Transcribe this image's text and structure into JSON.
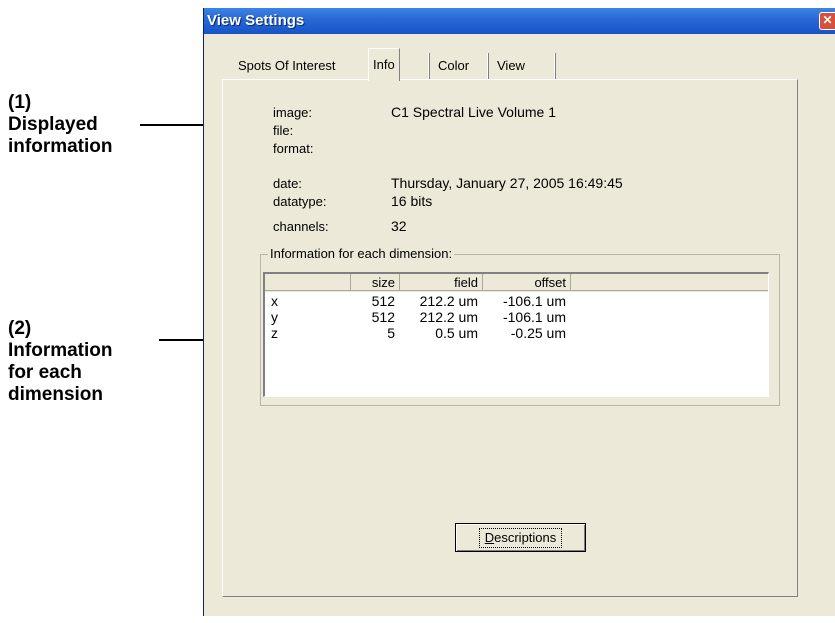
{
  "callouts": [
    {
      "number": "(1)",
      "lines": [
        "Displayed",
        "information"
      ]
    },
    {
      "number": "(2)",
      "lines": [
        "Information",
        "for each",
        "dimension"
      ]
    }
  ],
  "window": {
    "title": "View Settings",
    "close_glyph": "✕",
    "close_icon": "close-icon"
  },
  "tabs": [
    {
      "label": "Spots Of Interest",
      "active": false
    },
    {
      "label": "Info",
      "active": true
    },
    {
      "label": "Color",
      "active": false
    },
    {
      "label": "View",
      "active": false
    }
  ],
  "info": [
    {
      "label": "image:",
      "value": "C1 Spectral Live Volume 1"
    },
    {
      "label": "file:",
      "value": ""
    },
    {
      "label": "format:",
      "value": ""
    },
    {
      "label": "date:",
      "value": "Thursday, January 27, 2005 16:49:45"
    },
    {
      "label": "datatype:",
      "value": "16 bits"
    },
    {
      "label": "channels:",
      "value": "32"
    }
  ],
  "dimensions": {
    "title": "Information for each dimension:",
    "columns": [
      "",
      "size",
      "field",
      "offset"
    ],
    "rows": [
      {
        "name": "x",
        "size": "512",
        "field": "212.2 um",
        "offset": "-106.1 um"
      },
      {
        "name": "y",
        "size": "512",
        "field": "212.2 um",
        "offset": "-106.1 um"
      },
      {
        "name": "z",
        "size": "5",
        "field": "0.5 um",
        "offset": "-0.25 um"
      }
    ]
  },
  "descriptions_button": {
    "underlined": "D",
    "rest": "escriptions"
  }
}
